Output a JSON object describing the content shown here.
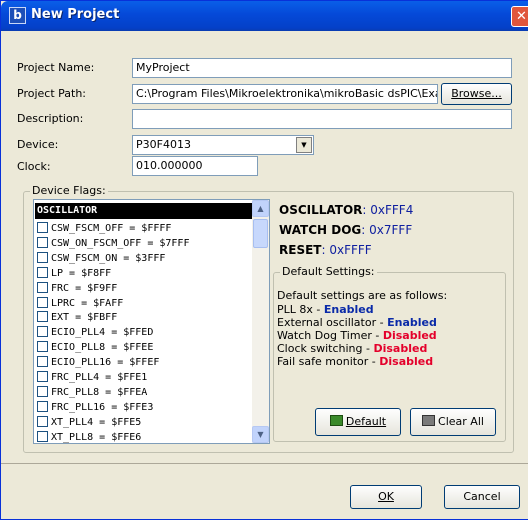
{
  "window": {
    "title": "New Project",
    "icon_glyph": "b",
    "close_glyph": "✕"
  },
  "form": {
    "project_name": {
      "label": "Project Name:",
      "value": "MyProject"
    },
    "project_path": {
      "label": "Project Path:",
      "value": "C:\\Program Files\\Mikroelektronika\\mikroBasic dsPIC\\Examples",
      "browse": "Browse..."
    },
    "description": {
      "label": "Description:",
      "value": ""
    },
    "device": {
      "label": "Device:",
      "value": "P30F4013",
      "arrow": "▼"
    },
    "clock": {
      "label": "Clock:",
      "value": "010.000000"
    }
  },
  "flags": {
    "group_title": "Device Flags:",
    "header": "OSCILLATOR",
    "items": [
      "CSW_FSCM_OFF = $FFFF",
      "CSW_ON_FSCM_OFF = $7FFF",
      "CSW_FSCM_ON = $3FFF",
      "LP = $F8FF",
      "FRC = $F9FF",
      "LPRC = $FAFF",
      "EXT = $FBFF",
      "ECIO_PLL4 = $FFED",
      "ECIO_PLL8 = $FFEE",
      "ECIO_PLL16 = $FFEF",
      "FRC_PLL4 = $FFE1",
      "FRC_PLL8 = $FFEA",
      "FRC_PLL16 = $FFE3",
      "XT_PLL4 = $FFE5",
      "XT_PLL8 = $FFE6"
    ],
    "scroll_up": "▲",
    "scroll_down": "▼"
  },
  "info": {
    "oscillator": {
      "key": "OSCILLATOR",
      "value": ": 0xFFF4"
    },
    "watchdog": {
      "key": "WATCH DOG",
      "value": ": 0x7FFF"
    },
    "reset": {
      "key": "RESET",
      "value": ": 0xFFFF"
    }
  },
  "defaults": {
    "group_title": "Default Settings:",
    "intro": "Default settings are as follows:",
    "lines": [
      {
        "name": "PLL 8x - ",
        "status": "Enabled"
      },
      {
        "name": "External oscillator - ",
        "status": "Enabled"
      },
      {
        "name": "Watch Dog Timer - ",
        "status": "Disabled"
      },
      {
        "name": "Clock switching - ",
        "status": "Disabled"
      },
      {
        "name": "Fail safe monitor - ",
        "status": "Disabled"
      }
    ],
    "default_button": "Default",
    "clear_all_button": "Clear All"
  },
  "footer": {
    "ok": "OK",
    "cancel": "Cancel"
  },
  "colors": {
    "enabled": "#0a2aa8",
    "disabled": "#e4002b",
    "title_bar": "#0549d8"
  }
}
